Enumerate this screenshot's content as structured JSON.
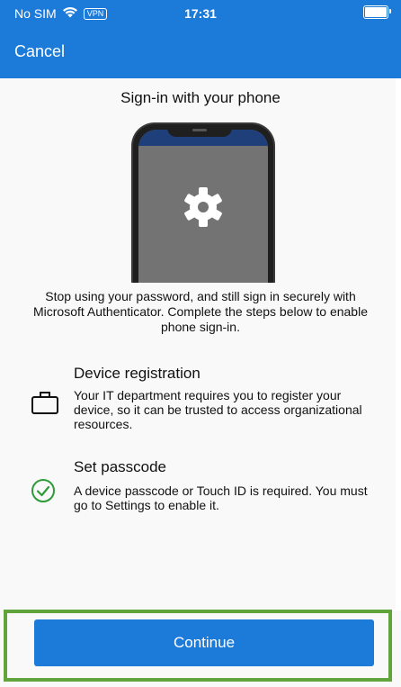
{
  "status_bar": {
    "carrier": "No SIM",
    "vpn_label": "VPN",
    "time": "17:31",
    "wifi_icon": "wifi-icon",
    "battery_icon": "battery-icon"
  },
  "nav": {
    "cancel_label": "Cancel"
  },
  "main": {
    "title": "Sign-in with your phone",
    "illustration_icon": "gear-icon",
    "description": "Stop using your password, and still sign in securely with Microsoft Authenticator. Complete the steps below to enable phone sign-in."
  },
  "steps": [
    {
      "icon": "briefcase-icon",
      "title": "Device registration",
      "text": "Your IT department requires you to register your device, so it can be trusted to access organizational resources."
    },
    {
      "icon": "checkmark-circle-icon",
      "title": "Set passcode",
      "text": "A device passcode or Touch ID is required. You must go to Settings to enable it."
    }
  ],
  "footer": {
    "continue_label": "Continue"
  },
  "colors": {
    "brand_blue": "#1c7ad9",
    "success_green": "#2e9b3a",
    "highlight_green": "#60a43b"
  }
}
